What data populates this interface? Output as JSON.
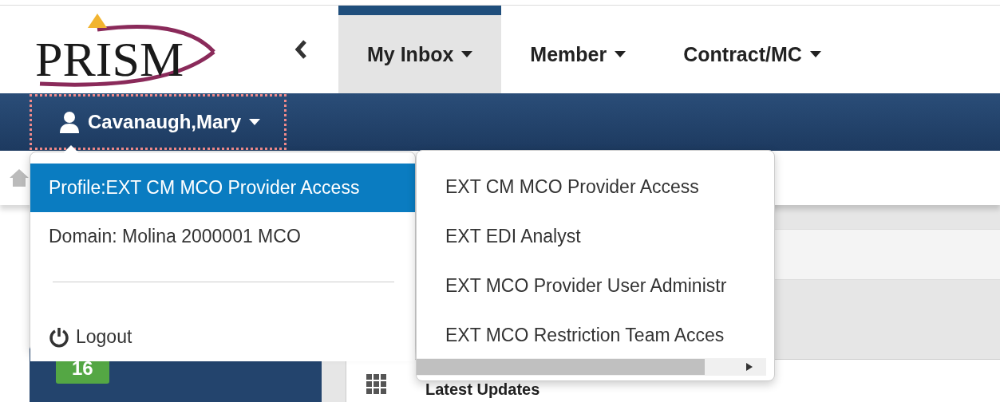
{
  "logo": {
    "text": "PRISM"
  },
  "nav_tabs": [
    {
      "label": "My Inbox",
      "selected": true
    },
    {
      "label": "Member",
      "selected": false
    },
    {
      "label": "Contract/MC",
      "selected": false
    }
  ],
  "user_bar": {
    "name": "Cavanaugh,Mary"
  },
  "user_menu": {
    "items": [
      {
        "kind": "profile",
        "label": "Profile:EXT CM MCO Provider Access",
        "selected": true
      },
      {
        "kind": "domain",
        "label": "Domain: Molina 2000001 MCO",
        "selected": false
      },
      {
        "kind": "divider"
      },
      {
        "kind": "logout",
        "label": "Logout",
        "selected": false
      }
    ]
  },
  "profile_submenu": {
    "items": [
      "EXT CM MCO Provider Access",
      "EXT EDI Analyst",
      "EXT MCO Provider User Administr",
      "EXT MCO Restriction Team Acces"
    ]
  },
  "sidebar": {
    "badge": "16"
  },
  "main": {
    "heading": "Latest Updates"
  }
}
